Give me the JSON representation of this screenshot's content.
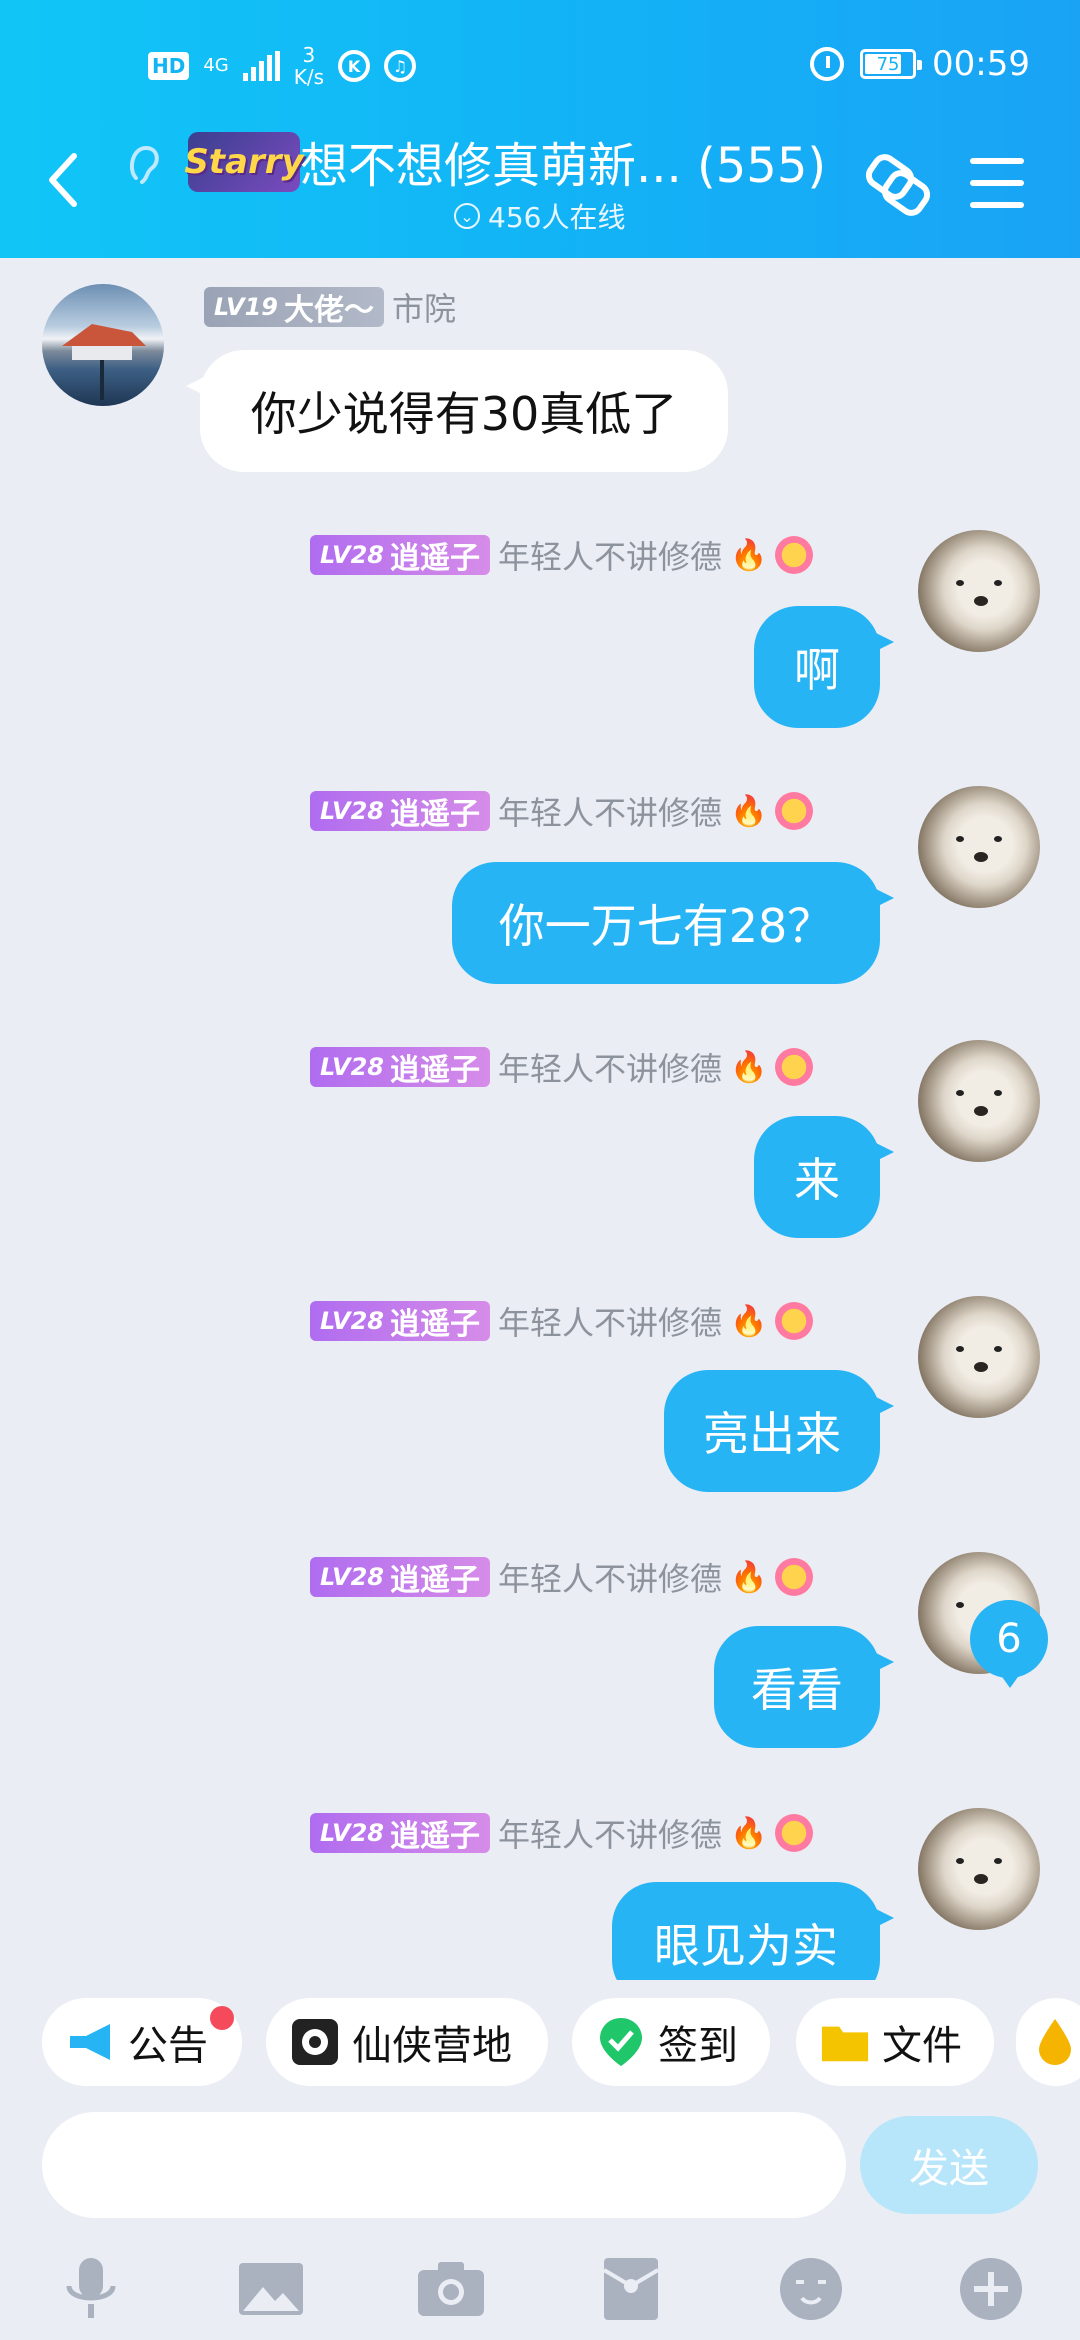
{
  "status_bar": {
    "hd": "HD",
    "network": "4G",
    "speed_value": "3",
    "speed_unit": "K/s",
    "app_icon_1": "K",
    "battery": "75",
    "time": "00:59"
  },
  "header": {
    "group_logo_text": "Starry",
    "title": "想不想修真萌新... (555)",
    "online": "456人在线"
  },
  "messages": [
    {
      "level": "LV19",
      "title": "大佬～",
      "name": "市院",
      "text": "你少说得有30真低了"
    },
    {
      "level": "LV28",
      "title": "逍遥子",
      "name": "年轻人不讲修德",
      "text": "啊"
    },
    {
      "level": "LV28",
      "title": "逍遥子",
      "name": "年轻人不讲修德",
      "text": "你一万七有28？"
    },
    {
      "level": "LV28",
      "title": "逍遥子",
      "name": "年轻人不讲修德",
      "text": "来"
    },
    {
      "level": "LV28",
      "title": "逍遥子",
      "name": "年轻人不讲修德",
      "text": "亮出来"
    },
    {
      "level": "LV28",
      "title": "逍遥子",
      "name": "年轻人不讲修德",
      "text": "看看"
    },
    {
      "level": "LV28",
      "title": "逍遥子",
      "name": "年轻人不讲修德",
      "text": "眼见为实"
    }
  ],
  "unread_count": "6",
  "shortcuts": [
    {
      "label": "公告",
      "icon": "megaphone-icon"
    },
    {
      "label": "仙侠营地",
      "icon": "camp-icon"
    },
    {
      "label": "签到",
      "icon": "check-in-icon"
    },
    {
      "label": "文件",
      "icon": "folder-icon"
    }
  ],
  "input": {
    "placeholder": "",
    "send_label": "发送"
  },
  "toolbar": [
    "mic-icon",
    "image-icon",
    "camera-icon",
    "red-packet-icon",
    "emoji-icon",
    "plus-icon"
  ],
  "colors": {
    "header": "#12b4f6",
    "bubble_out": "#27b4f5",
    "bubble_in": "#ffffff",
    "background": "#eaedf4",
    "level_purple": "#c07ef0",
    "level_gray": "#a5adbf"
  }
}
